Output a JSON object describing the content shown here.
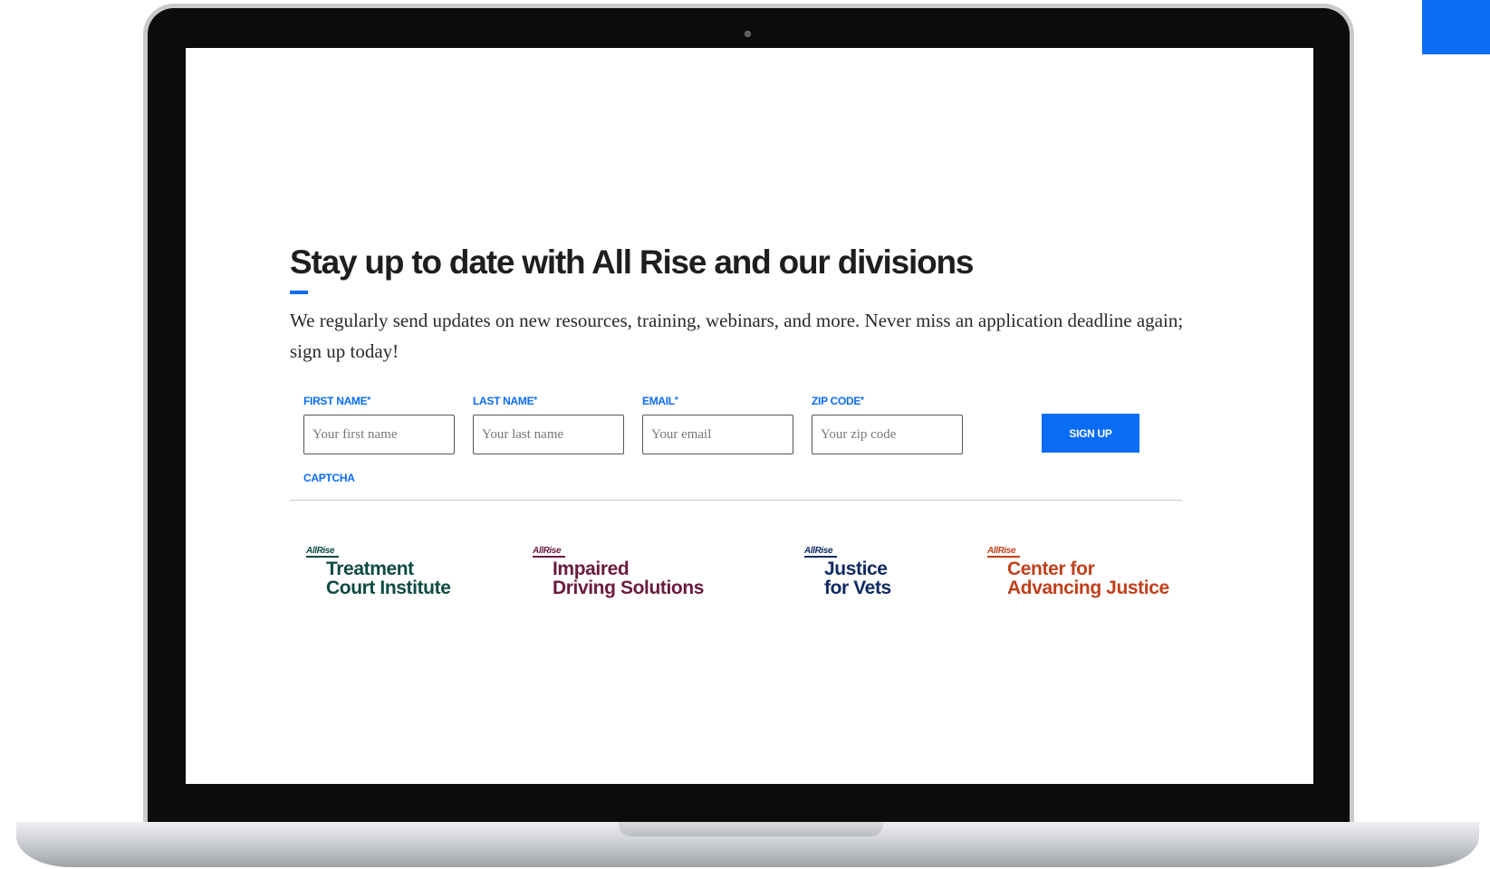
{
  "signup": {
    "headline": "Stay up to date with All Rise and our divisions",
    "intro": "We regularly send updates on new resources, training, webinars, and more. Never miss an application deadline again; sign up today!",
    "required_mark": "*",
    "fields": [
      {
        "label": "FIRST NAME",
        "placeholder": "Your first name"
      },
      {
        "label": "LAST NAME",
        "placeholder": "Your last name"
      },
      {
        "label": "EMAIL",
        "placeholder": "Your email"
      },
      {
        "label": "ZIP CODE",
        "placeholder": "Your zip code"
      }
    ],
    "button_label": "SIGN UP",
    "captcha_label": "CAPTCHA"
  },
  "divisions": [
    {
      "brand": "AllRise",
      "line1": "Treatment",
      "line2": "Court Institute",
      "color": "#0d4a43"
    },
    {
      "brand": "AllRise",
      "line1": "Impaired",
      "line2": "Driving Solutions",
      "color": "#6b1a3e"
    },
    {
      "brand": "AllRise",
      "line1": "Justice",
      "line2": "for Vets",
      "color": "#0f2a63"
    },
    {
      "brand": "AllRise",
      "line1": "Center for",
      "line2": "Advancing Justice",
      "color": "#c0401b"
    }
  ],
  "colors": {
    "accent": "#0a6cf5",
    "heading": "#1e1e1e"
  }
}
